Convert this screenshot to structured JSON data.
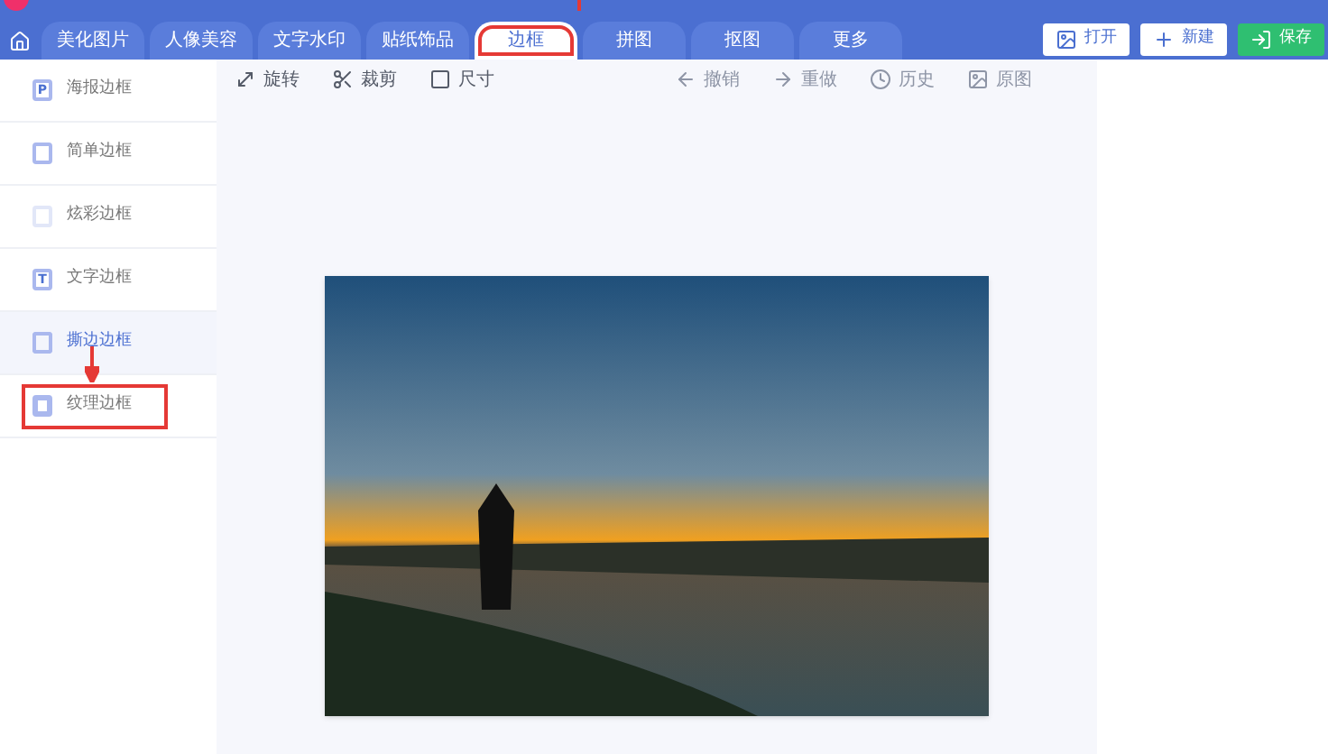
{
  "tabs": [
    {
      "label": "美化图片",
      "selected": false
    },
    {
      "label": "人像美容",
      "selected": false
    },
    {
      "label": "文字水印",
      "selected": false
    },
    {
      "label": "贴纸饰品",
      "selected": false
    },
    {
      "label": "边框",
      "selected": true
    },
    {
      "label": "拼图",
      "selected": false
    },
    {
      "label": "抠图",
      "selected": false
    },
    {
      "label": "更多",
      "selected": false
    }
  ],
  "actions": [
    {
      "kind": "open",
      "label": "打开"
    },
    {
      "kind": "new",
      "label": "新建"
    },
    {
      "kind": "save",
      "label": "保存"
    }
  ],
  "sidebar": {
    "items": [
      {
        "kind": "poster",
        "glyph": "P",
        "label": "海报边框",
        "selected": false
      },
      {
        "kind": "simple",
        "label": "简单边框",
        "selected": false
      },
      {
        "kind": "color",
        "label": "炫彩边框",
        "selected": false
      },
      {
        "kind": "text",
        "glyph": "T",
        "label": "文字边框",
        "selected": false
      },
      {
        "kind": "torn",
        "label": "撕边边框",
        "selected": true
      },
      {
        "kind": "texture",
        "label": "纹理边框",
        "selected": false
      }
    ]
  },
  "toolbar": {
    "left": [
      {
        "kind": "rotate",
        "label": "旋转",
        "disabled": false
      },
      {
        "kind": "crop",
        "label": "裁剪",
        "disabled": false
      },
      {
        "kind": "size",
        "label": "尺寸",
        "disabled": false
      }
    ],
    "right": [
      {
        "kind": "undo",
        "label": "撤销",
        "disabled": true
      },
      {
        "kind": "redo",
        "label": "重做",
        "disabled": true
      },
      {
        "kind": "history",
        "label": "历史",
        "disabled": true
      },
      {
        "kind": "original",
        "label": "原图",
        "disabled": true
      }
    ]
  }
}
